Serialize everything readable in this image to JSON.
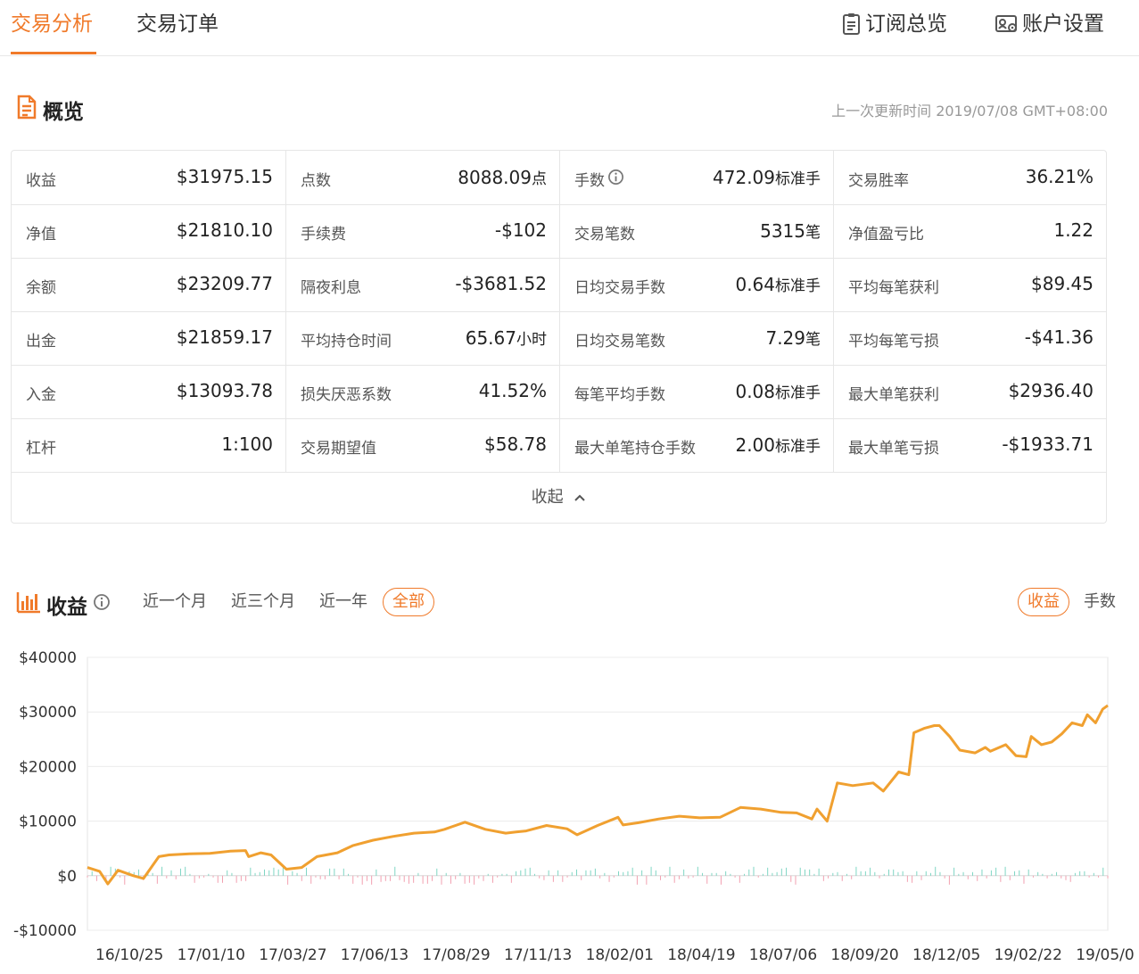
{
  "nav": {
    "tabs": [
      "交易分析",
      "交易订单"
    ],
    "active_tab": "交易分析",
    "links": [
      {
        "label": "订阅总览",
        "icon": "clipboard-icon"
      },
      {
        "label": "账户设置",
        "icon": "account-settings-icon"
      }
    ]
  },
  "overview": {
    "title": "概览",
    "icon": "document-icon",
    "updated": "上一次更新时间 2019/07/08 GMT+08:00",
    "rows": [
      [
        {
          "label": "收益",
          "value": "$31975.15",
          "unit": ""
        },
        {
          "label": "点数",
          "value": "8088.09",
          "unit": "点"
        },
        {
          "label": "手数",
          "value": "472.09",
          "unit": "标准手",
          "info": true
        },
        {
          "label": "交易胜率",
          "value": "36.21%",
          "unit": ""
        }
      ],
      [
        {
          "label": "净值",
          "value": "$21810.10",
          "unit": ""
        },
        {
          "label": "手续费",
          "value": "-$102",
          "unit": ""
        },
        {
          "label": "交易笔数",
          "value": "5315",
          "unit": "笔"
        },
        {
          "label": "净值盈亏比",
          "value": "1.22",
          "unit": ""
        }
      ],
      [
        {
          "label": "余额",
          "value": "$23209.77",
          "unit": ""
        },
        {
          "label": "隔夜利息",
          "value": "-$3681.52",
          "unit": ""
        },
        {
          "label": "日均交易手数",
          "value": "0.64",
          "unit": "标准手"
        },
        {
          "label": "平均每笔获利",
          "value": "$89.45",
          "unit": ""
        }
      ],
      [
        {
          "label": "出金",
          "value": "$21859.17",
          "unit": ""
        },
        {
          "label": "平均持仓时间",
          "value": "65.67",
          "unit": "小时"
        },
        {
          "label": "日均交易笔数",
          "value": "7.29",
          "unit": "笔"
        },
        {
          "label": "平均每笔亏损",
          "value": "-$41.36",
          "unit": ""
        }
      ],
      [
        {
          "label": "入金",
          "value": "$13093.78",
          "unit": ""
        },
        {
          "label": "损失厌恶系数",
          "value": "41.52%",
          "unit": ""
        },
        {
          "label": "每笔平均手数",
          "value": "0.08",
          "unit": "标准手"
        },
        {
          "label": "最大单笔获利",
          "value": "$2936.40",
          "unit": ""
        }
      ],
      [
        {
          "label": "杠杆",
          "value": "1:100",
          "unit": ""
        },
        {
          "label": "交易期望值",
          "value": "$58.78",
          "unit": ""
        },
        {
          "label": "最大单笔持仓手数",
          "value": "2.00",
          "unit": "标准手"
        },
        {
          "label": "最大单笔亏损",
          "value": "-$1933.71",
          "unit": ""
        }
      ]
    ],
    "collapse_label": "收起"
  },
  "earnings": {
    "title": "收益",
    "icon": "bar-chart-icon",
    "ranges": [
      "近一个月",
      "近三个月",
      "近一年",
      "全部"
    ],
    "active_range": "全部",
    "modes": [
      "收益",
      "手数"
    ],
    "active_mode": "收益"
  },
  "colors": {
    "accent": "#f07a2a",
    "line": "#f0a030",
    "bar_up": "#7fd6c4",
    "bar_down": "#f2a0b0"
  },
  "chart_data": {
    "type": "line",
    "ylim": [
      -10000,
      40000
    ],
    "yticks": [
      "$40000",
      "$30000",
      "$20000",
      "$10000",
      "$0",
      "-$10000"
    ],
    "ytick_values": [
      40000,
      30000,
      20000,
      10000,
      0,
      -10000
    ],
    "xticks": [
      "16/10/25",
      "17/01/10",
      "17/03/27",
      "17/06/13",
      "17/08/29",
      "17/11/13",
      "18/02/01",
      "18/04/19",
      "18/07/06",
      "18/09/20",
      "18/12/05",
      "19/02/22",
      "19/05/0"
    ],
    "series": [
      {
        "kind": "cumulative-earnings",
        "x": [
          0,
          0.012,
          0.02,
          0.03,
          0.045,
          0.055,
          0.07,
          0.08,
          0.1,
          0.12,
          0.14,
          0.155,
          0.158,
          0.17,
          0.18,
          0.195,
          0.21,
          0.225,
          0.245,
          0.26,
          0.28,
          0.3,
          0.32,
          0.34,
          0.35,
          0.37,
          0.39,
          0.41,
          0.42,
          0.43,
          0.45,
          0.47,
          0.48,
          0.5,
          0.52,
          0.525,
          0.54,
          0.56,
          0.58,
          0.6,
          0.62,
          0.64,
          0.66,
          0.68,
          0.695,
          0.71,
          0.715,
          0.725,
          0.735,
          0.75,
          0.77,
          0.78,
          0.795,
          0.805,
          0.81,
          0.82,
          0.83,
          0.835,
          0.845,
          0.855,
          0.87,
          0.88,
          0.885,
          0.9,
          0.91,
          0.92,
          0.925,
          0.935,
          0.945,
          0.955,
          0.965,
          0.975,
          0.98,
          0.988,
          0.995,
          1.0
        ],
        "y": [
          1500,
          800,
          -1500,
          1000,
          0,
          -500,
          3500,
          3800,
          4000,
          4100,
          4500,
          4600,
          3500,
          4200,
          3800,
          1200,
          1500,
          3500,
          4200,
          5500,
          6500,
          7200,
          7800,
          8000,
          8500,
          9800,
          8500,
          7800,
          8000,
          8200,
          9200,
          8600,
          7500,
          9200,
          10700,
          9300,
          9700,
          10400,
          10900,
          10600,
          10700,
          12500,
          12200,
          11600,
          11500,
          10400,
          12200,
          10000,
          17000,
          16500,
          17000,
          15500,
          19000,
          18500,
          26200,
          27000,
          27500,
          27500,
          25500,
          23000,
          22500,
          23500,
          22800,
          24000,
          22000,
          21800,
          25500,
          24000,
          24500,
          26000,
          28000,
          27500,
          29500,
          28000,
          30500,
          31200
        ]
      }
    ]
  }
}
